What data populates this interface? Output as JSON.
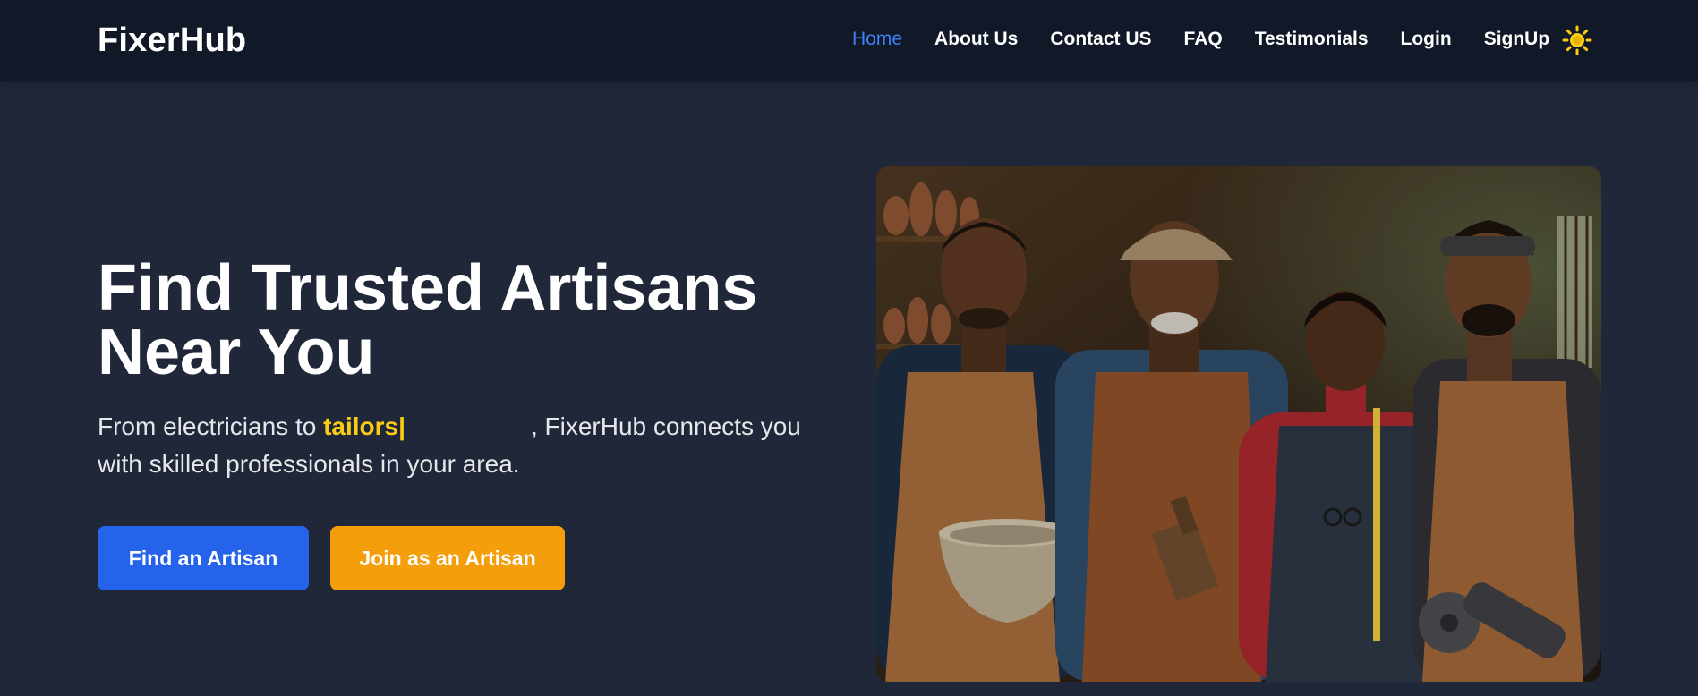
{
  "brand": {
    "name": "FixerHub"
  },
  "nav": {
    "items": [
      {
        "label": "Home",
        "active": true
      },
      {
        "label": "About Us",
        "active": false
      },
      {
        "label": "Contact US",
        "active": false
      },
      {
        "label": "FAQ",
        "active": false
      },
      {
        "label": "Testimonials",
        "active": false
      },
      {
        "label": "Login",
        "active": false
      },
      {
        "label": "SignUp",
        "active": false
      }
    ],
    "theme_toggle_icon": "sun-icon"
  },
  "hero": {
    "title_line1": "Find Trusted Artisans",
    "title_line2": "Near You",
    "subtitle_prefix": "From electricians to",
    "typed_word": "tailors|",
    "subtitle_suffix": ", FixerHub connects you with skilled professionals in your area.",
    "primary_button": "Find an Artisan",
    "secondary_button": "Join as an Artisan",
    "image_icon": "artisans-photo"
  },
  "colors": {
    "nav_bg": "#111827",
    "page_bg": "#1f2738",
    "accent_blue": "#2563eb",
    "active_link": "#3b82f6",
    "accent_yellow": "#facc15",
    "button_orange": "#f59e0b"
  }
}
